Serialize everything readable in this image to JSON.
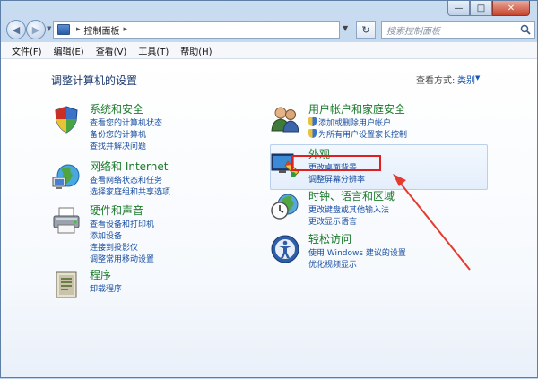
{
  "window": {
    "caption_min": "—",
    "caption_max": "□",
    "caption_close": "✕"
  },
  "address": {
    "back": "◀",
    "forward": "▶",
    "separator": "▸",
    "path": "控制面板",
    "path_arrow": "▸",
    "refresh": "↻",
    "search_placeholder": "搜索控制面板"
  },
  "menu": [
    "文件(F)",
    "编辑(E)",
    "查看(V)",
    "工具(T)",
    "帮助(H)"
  ],
  "page": {
    "title": "调整计算机的设置",
    "view_by_label": "查看方式:",
    "view_by_value": "类别"
  },
  "categories": {
    "system": {
      "title": "系统和安全",
      "icon": "shield-icon",
      "links": [
        "查看您的计算机状态",
        "备份您的计算机",
        "查找并解决问题"
      ]
    },
    "network": {
      "title": "网络和 Internet",
      "icon": "network-icon",
      "links": [
        "查看网络状态和任务",
        "选择家庭组和共享选项"
      ]
    },
    "hardware": {
      "title": "硬件和声音",
      "icon": "printer-icon",
      "links": [
        "查看设备和打印机",
        "添加设备",
        "连接到投影仪",
        "调整常用移动设置"
      ]
    },
    "programs": {
      "title": "程序",
      "icon": "programs-icon",
      "links": [
        "卸载程序"
      ]
    },
    "users": {
      "title": "用户帐户和家庭安全",
      "icon": "users-icon",
      "links": [
        "添加或删除用户帐户",
        "为所有用户设置家长控制"
      ]
    },
    "appearance": {
      "title": "外观",
      "icon": "appearance-icon",
      "links": [
        "更改桌面背景",
        "调整屏幕分辨率"
      ]
    },
    "clock": {
      "title": "时钟、语言和区域",
      "icon": "clock-icon",
      "links": [
        "更改键盘或其他输入法",
        "更改显示语言"
      ]
    },
    "ease": {
      "title": "轻松访问",
      "icon": "ease-of-access-icon",
      "links": [
        "使用 Windows 建议的设置",
        "优化视频显示"
      ]
    }
  },
  "colors": {
    "category_title": "#1a7a2a",
    "link": "#1a4fa0",
    "annotation_red": "#e02020"
  }
}
